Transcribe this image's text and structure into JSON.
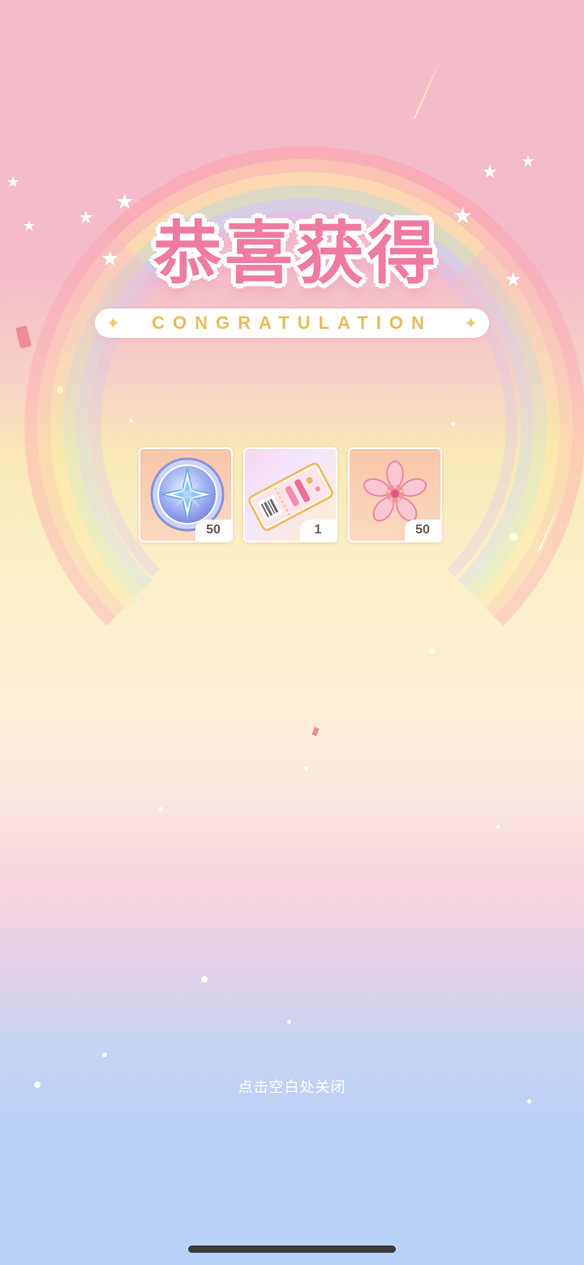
{
  "header": {
    "title": "恭喜获得",
    "subtitle": "CONGRATULATION"
  },
  "rewards": [
    {
      "icon": "star-coin-icon",
      "count": "50"
    },
    {
      "icon": "ticket-icon",
      "count": "1"
    },
    {
      "icon": "sakura-flower-icon",
      "count": "50"
    }
  ],
  "footer": {
    "close_hint": "点击空白处关闭"
  },
  "colors": {
    "title_pink": "#f07ba0",
    "banner_gold": "#e8bd5a",
    "card_bg": "#f8c6a8",
    "bottom_blue": "#b8d2f7"
  }
}
